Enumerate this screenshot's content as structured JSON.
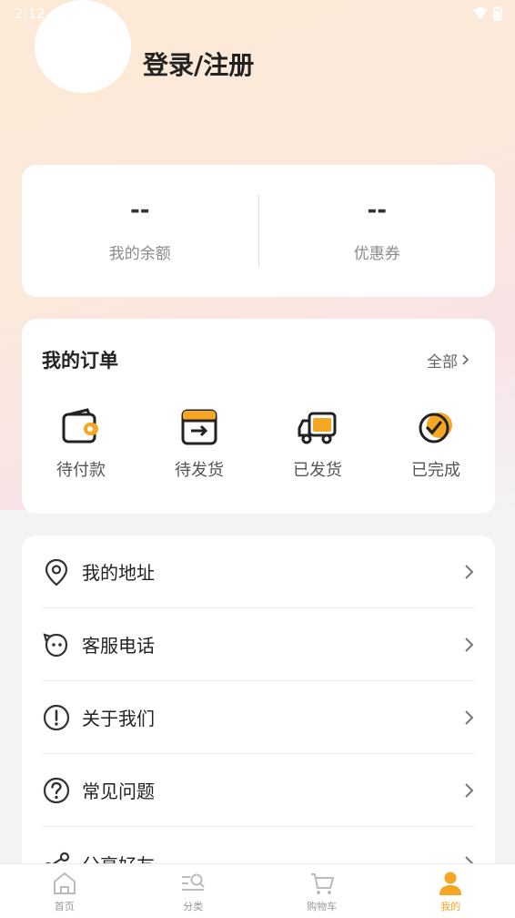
{
  "status_bar": {
    "time": "2:12"
  },
  "profile": {
    "login_label": "登录/注册"
  },
  "balance": {
    "balance_value": "--",
    "balance_label": "我的余额",
    "coupon_value": "--",
    "coupon_label": "优惠券"
  },
  "orders": {
    "title": "我的订单",
    "all_label": "全部",
    "items": [
      {
        "label": "待付款",
        "icon": "wallet-icon"
      },
      {
        "label": "待发货",
        "icon": "package-icon"
      },
      {
        "label": "已发货",
        "icon": "truck-icon"
      },
      {
        "label": "已完成",
        "icon": "check-circle-icon"
      }
    ]
  },
  "menu": {
    "items": [
      {
        "label": "我的地址",
        "icon": "location-pin-icon"
      },
      {
        "label": "客服电话",
        "icon": "customer-service-icon"
      },
      {
        "label": "关于我们",
        "icon": "info-icon"
      },
      {
        "label": "常见问题",
        "icon": "question-icon"
      },
      {
        "label": "分享好友",
        "icon": "share-icon"
      }
    ]
  },
  "tabbar": {
    "items": [
      {
        "label": "首页",
        "icon": "home-icon",
        "active": false
      },
      {
        "label": "分类",
        "icon": "category-icon",
        "active": false
      },
      {
        "label": "购物车",
        "icon": "cart-icon",
        "active": false
      },
      {
        "label": "我的",
        "icon": "user-icon",
        "active": true
      }
    ],
    "accent_color": "#f5a623"
  }
}
